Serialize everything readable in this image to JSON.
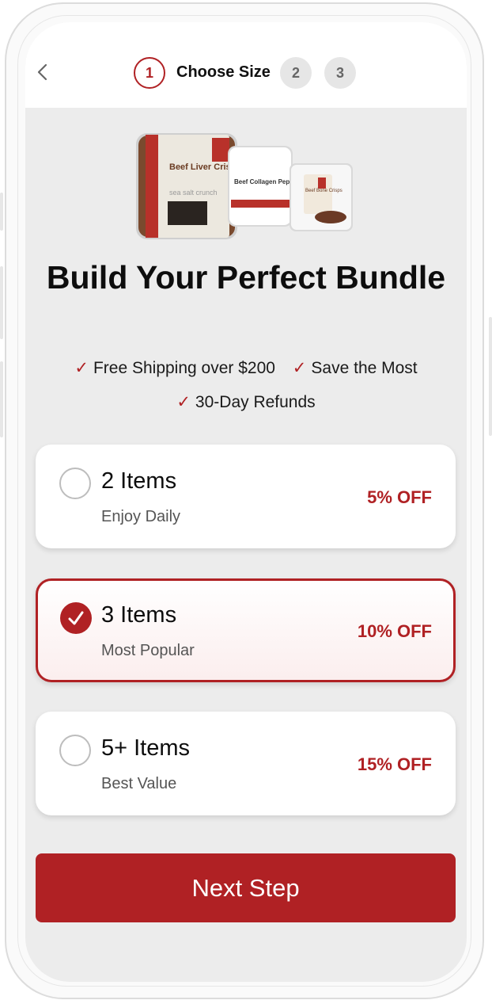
{
  "header": {
    "steps": [
      {
        "number": "1",
        "label": "Choose Size",
        "active": true
      },
      {
        "number": "2",
        "active": false
      },
      {
        "number": "3",
        "active": false
      }
    ]
  },
  "hero": {
    "product_texts": [
      "Beef Liver Crisps",
      "sea salt crunch",
      "Beef Collagen Peptides",
      "Beef Bone Crisps"
    ]
  },
  "title": "Build Your Perfect Bundle",
  "perks": [
    "Free Shipping over $200",
    "Save the Most",
    "30-Day Refunds"
  ],
  "options": [
    {
      "title": "2 Items",
      "subtitle": "Enjoy Daily",
      "discount": "5% OFF",
      "selected": false
    },
    {
      "title": "3 Items",
      "subtitle": "Most Popular",
      "discount": "10% OFF",
      "selected": true
    },
    {
      "title": "5+ Items",
      "subtitle": "Best Value",
      "discount": "15% OFF",
      "selected": false
    }
  ],
  "next_button": "Next Step",
  "colors": {
    "accent": "#b02124",
    "screen_bg": "#ececec"
  }
}
